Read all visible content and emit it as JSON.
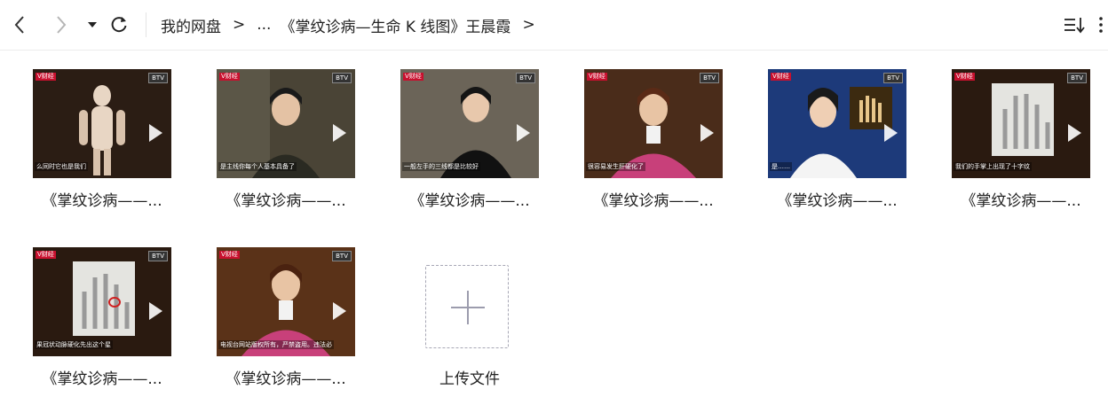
{
  "toolbar": {
    "back_icon": "chevron-left-icon",
    "forward_icon": "chevron-right-icon",
    "dropdown_icon": "caret-down-icon",
    "refresh_icon": "refresh-icon",
    "sort_icon": "sort-icon",
    "more_icon": "vertical-ellipsis-icon"
  },
  "breadcrumb": {
    "root": "我的网盘",
    "ellipsis": "...",
    "current": "《掌纹诊病—生命 K 线图》王晨霞",
    "separator": ">"
  },
  "files": [
    {
      "name": "《掌纹诊病——...",
      "caption": "么同时它也是我们",
      "scene": "body"
    },
    {
      "name": "《掌纹诊病——...",
      "caption": "是主线你每个人基本具备了",
      "scene": "woman-dark"
    },
    {
      "name": "《掌纹诊病——...",
      "caption": "一般左手的三线都是比较好",
      "scene": "woman-black"
    },
    {
      "name": "《掌纹诊病——...",
      "caption": "很容易发生肝硬化了",
      "scene": "woman-pink"
    },
    {
      "name": "《掌纹诊病——...",
      "caption": "是……",
      "scene": "anchor"
    },
    {
      "name": "《掌纹诊病——...",
      "caption": "我们的手掌上出现了十字纹",
      "scene": "palm"
    },
    {
      "name": "《掌纹诊病——...",
      "caption": "果冠状动脉硬化先出这个星",
      "scene": "palm-red"
    },
    {
      "name": "《掌纹诊病——...",
      "caption": "电视台网站版权所有，严禁盗用。违法必",
      "scene": "woman-pink2"
    }
  ],
  "thumb_badges": {
    "left": "V财经",
    "right": "BTV"
  },
  "upload": {
    "label": "上传文件",
    "icon": "plus-icon"
  }
}
